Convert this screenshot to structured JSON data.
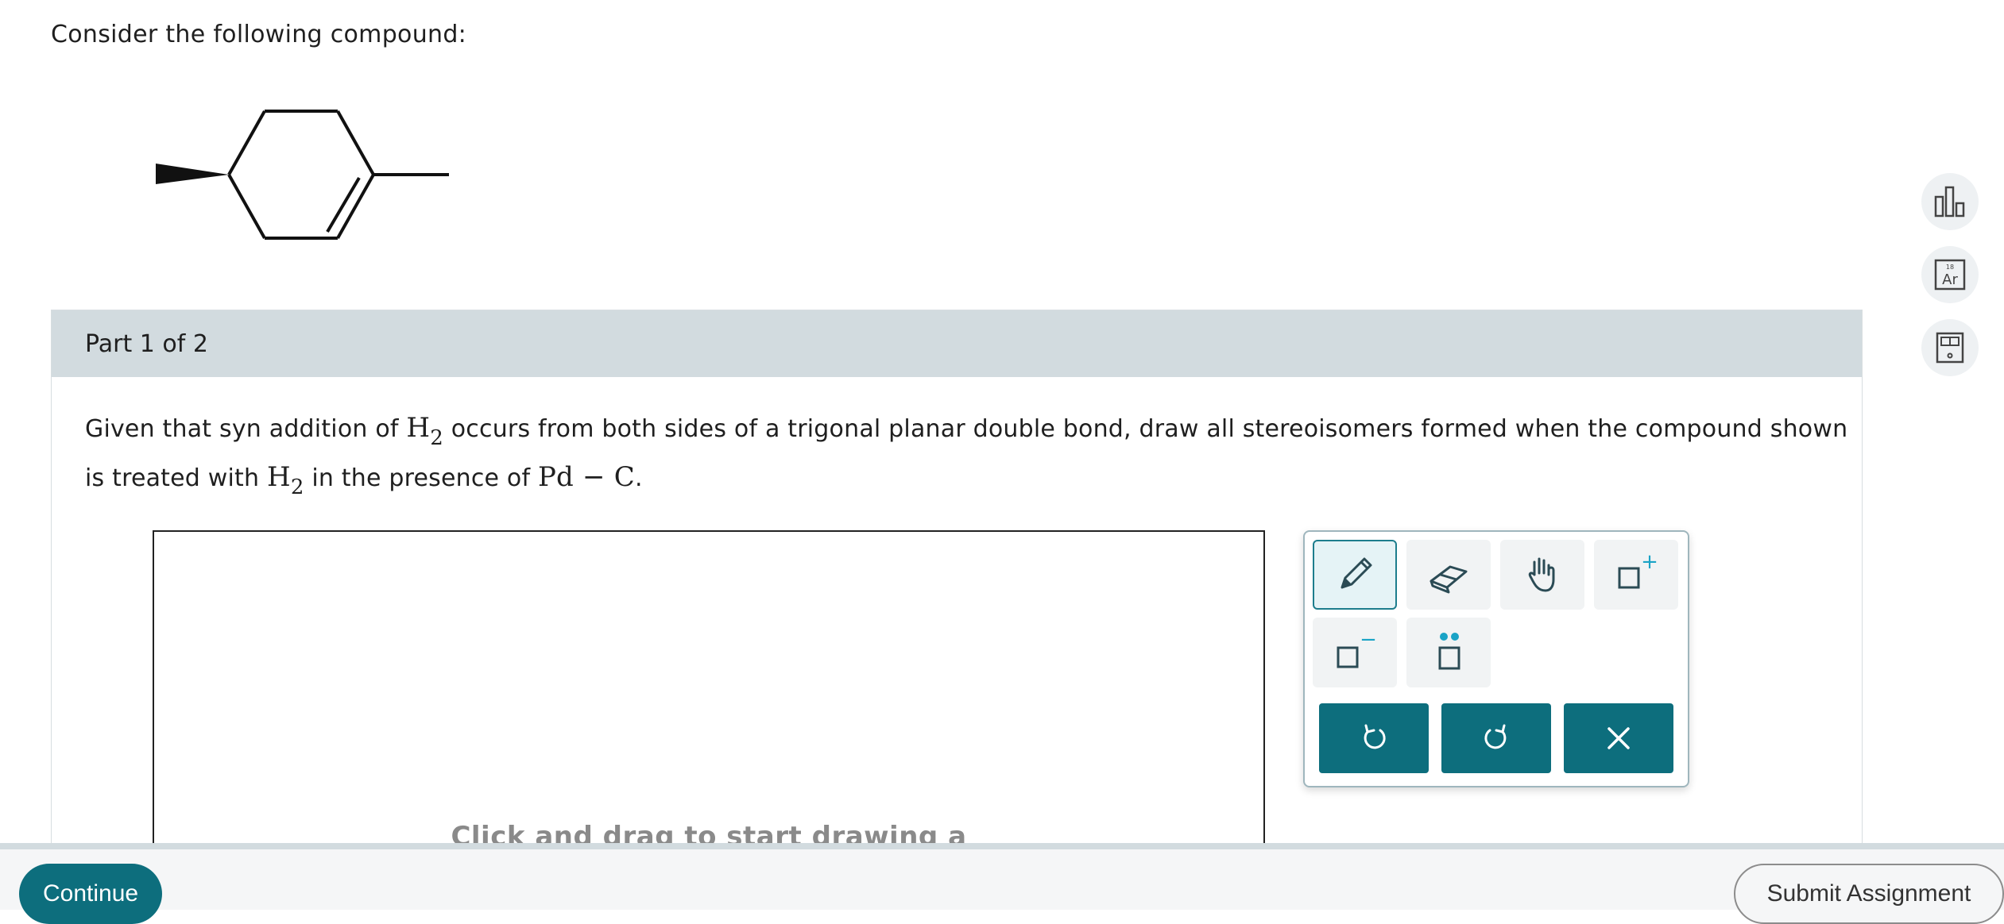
{
  "intro": {
    "text": "Consider the following compound:"
  },
  "part": {
    "label": "Part 1 of 2",
    "question": {
      "t1": "Given that syn addition of ",
      "h2_base_1": "H",
      "h2_sub_1": "2",
      "t2": " occurs from both sides of a trigonal planar double bond, draw all stereoisomers formed when the compound shown is treated with ",
      "h2_base_2": "H",
      "h2_sub_2": "2",
      "t3": " in the presence of ",
      "catalyst": "Pd − C",
      "t4": "."
    }
  },
  "canvas": {
    "hint": "Click and drag to start drawing a"
  },
  "side_tools": {
    "periodic_label": "Ar",
    "periodic_number": "18"
  },
  "toolbox": {
    "icons": [
      "pencil-icon",
      "eraser-icon",
      "hand-icon",
      "add-charge-icon",
      "remove-charge-icon",
      "lone-pair-icon",
      "undo-icon",
      "redo-icon",
      "clear-icon"
    ],
    "add_charge_sign": "+",
    "remove_charge_sign": "−"
  },
  "footer": {
    "continue_label": "Continue",
    "submit_label": "Submit Assignment"
  },
  "colors": {
    "accent": "#0d6e7d",
    "header_bg": "#d2dbdf",
    "charge_blue": "#1aa3c6"
  }
}
